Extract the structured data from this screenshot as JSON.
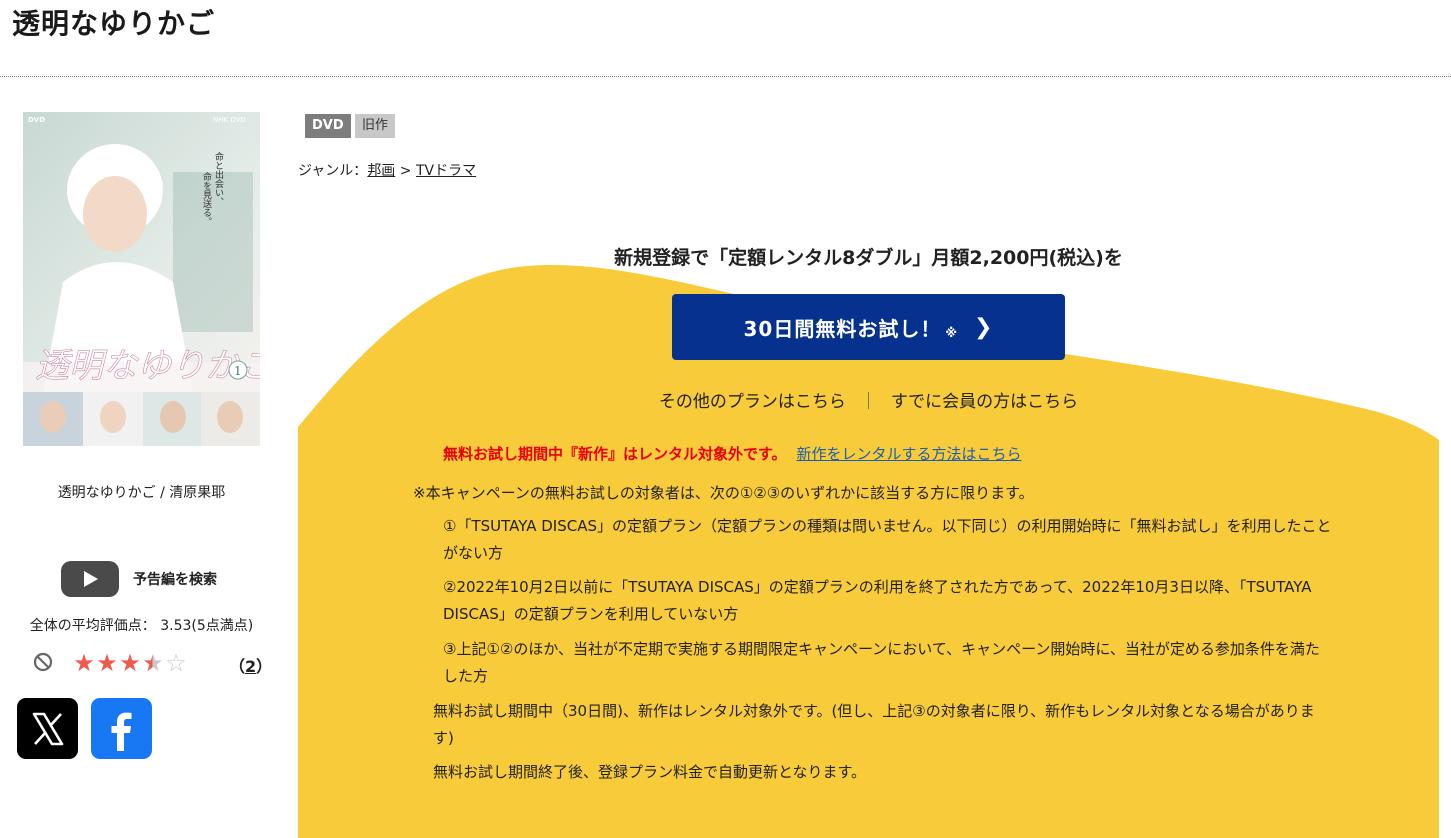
{
  "page": {
    "title": "透明なゆりかご"
  },
  "product": {
    "cover_alt": "透明なゆりかご",
    "caption": "透明なゆりかご / 清原果耶",
    "cover_text": {
      "dvd_mark": "DVD",
      "brand_mark": "NHK DVD",
      "tagline_1": "命と出会い、",
      "tagline_2": "命を見送る。",
      "title_script": "透明なゆりかご",
      "volume": "1"
    },
    "badges": [
      "DVD",
      "旧作"
    ],
    "genre_label": "ジャンル：",
    "genre_path": [
      "邦画",
      "TVドラマ"
    ],
    "genre_sep": " > "
  },
  "trailer": {
    "label": "予告編を検索",
    "icon": "youtube-play-icon"
  },
  "rating": {
    "average_text": "全体の平均評価点： 3.53(5点満点)",
    "average": 3.53,
    "max": 5,
    "stars": [
      "full",
      "full",
      "full",
      "half",
      "empty"
    ],
    "count_open": "（",
    "count": "2",
    "count_close": "）"
  },
  "share": {
    "x_icon": "x-logo-icon",
    "facebook_icon": "facebook-logo-icon"
  },
  "promo": {
    "headline": "新規登録で「定額レンタル8ダブル」月額2,200円(税込)を",
    "cta_label": "30日間無料お試し！",
    "cta_note": "※",
    "other_plans": "その他のプランはこちら",
    "separator": "｜",
    "members": "すでに会員の方はこちら",
    "warning": "無料お試し期間中『新作』はレンタル対象外です。",
    "warning_link": "新作をレンタルする方法はこちら",
    "terms_intro": "※本キャンペーンの無料お試しの対象者は、次の①②③のいずれかに該当する方に限ります。",
    "terms_1": "①「TSUTAYA DISCAS」の定額プラン（定額プランの種類は問いません。以下同じ）の利用開始時に「無料お試し」を利用したことがない方",
    "terms_2": "②2022年10月2日以前に「TSUTAYA DISCAS」の定額プランの利用を終了された方であって、2022年10月3日以降、「TSUTAYA DISCAS」の定額プランを利用していない方",
    "terms_3": "③上記①②のほか、当社が不定期で実施する期間限定キャンペーンにおいて、キャンペーン開始時に、当社が定める参加条件を満たした方",
    "terms_4": "無料お試し期間中（30日間)、新作はレンタル対象外です。(但し、上記③の対象者に限り、新作もレンタル対象となる場合があります)",
    "terms_5": "無料お試し期間終了後、登録プラン料金で自動更新となります。"
  },
  "colors": {
    "promo_yellow": "#f8cb3a",
    "cta_blue": "#06318f",
    "warning_red": "#e8000b",
    "link_blue": "#1c5fb0",
    "star_red": "#ef5b4b",
    "facebook_blue": "#1877f2"
  }
}
